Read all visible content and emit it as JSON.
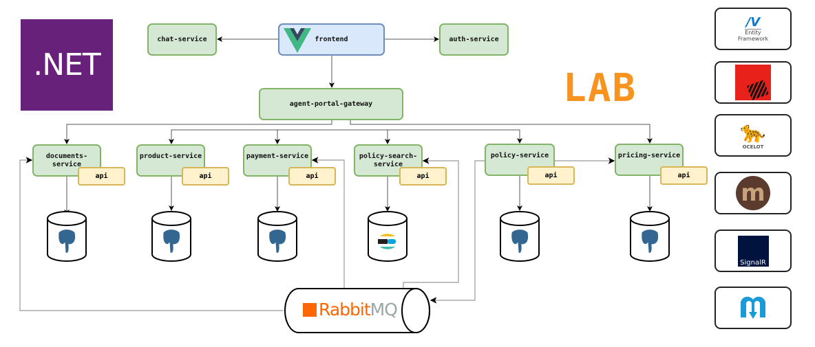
{
  "brand": {
    "dotnet": ".NET",
    "lab": "LAB"
  },
  "nodes": {
    "frontend": "frontend",
    "chat": "chat-service",
    "auth": "auth-service",
    "gateway": "agent-portal-gateway",
    "services": [
      {
        "name": "documents-service",
        "api": "api",
        "db": "postgresql"
      },
      {
        "name": "product-service",
        "api": "api",
        "db": "postgresql"
      },
      {
        "name": "payment-service",
        "api": "api",
        "db": "postgresql"
      },
      {
        "name": "policy-search-service",
        "api": "api",
        "db": "elasticsearch"
      },
      {
        "name": "policy-service",
        "api": "api",
        "db": "postgresql"
      },
      {
        "name": "pricing-service",
        "api": "api",
        "db": "postgresql"
      }
    ],
    "broker": {
      "part1": "Rabbit",
      "part2": "MQ"
    }
  },
  "logos": {
    "entity_framework": {
      "line1": "Entity",
      "line2": "Framework"
    },
    "ocelot": "OCELOT",
    "signalr": "SignalR",
    "others": [
      "serilog-icon",
      "mediatr-icon",
      "marten-icon"
    ]
  },
  "colors": {
    "service_fill": "#d5e8d4",
    "service_border": "#82b366",
    "api_fill": "#fff2cc",
    "api_border": "#d6b656",
    "frontend_fill": "#dae8fc",
    "dotnet": "#68217a",
    "lab": "#f7931e",
    "rabbit": "#ff6600"
  }
}
